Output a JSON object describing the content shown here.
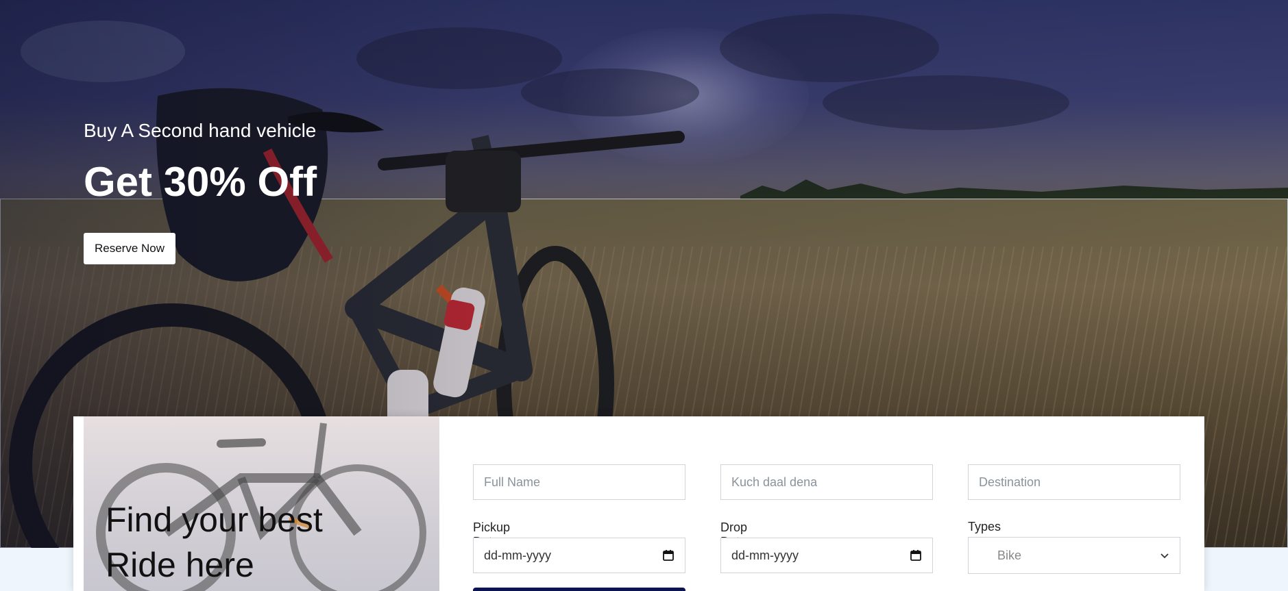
{
  "hero": {
    "subtitle": "Buy A Second hand vehicle",
    "title": "Get 30% Off",
    "cta_label": "Reserve Now"
  },
  "promo": {
    "title_line1": "Find your best",
    "title_line2": "Ride here"
  },
  "form": {
    "full_name_placeholder": "Full Name",
    "second_placeholder": "Kuch daal dena",
    "destination_placeholder": "Destination",
    "pickup_label": "Pickup Date",
    "pickup_value": "dd-mm-yyyy",
    "drop_label": "Drop Date",
    "drop_value": "dd-mm-yyyy",
    "types_label": "Types",
    "types_selected": "Bike"
  },
  "colors": {
    "submit": "#0b1350",
    "card_bg": "#ffffff",
    "page_bg": "#eef5fc"
  }
}
